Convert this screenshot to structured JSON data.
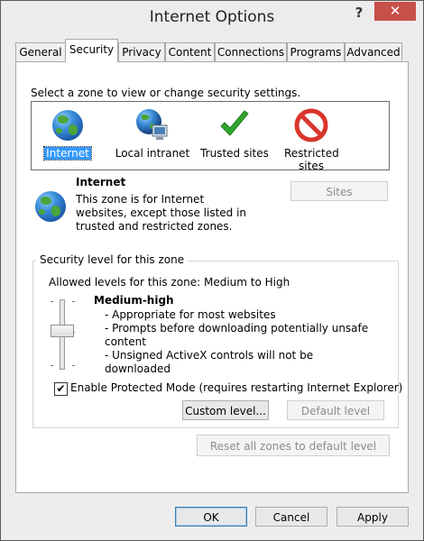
{
  "window": {
    "title": "Internet Options",
    "help_label": "?",
    "close_label": "✕"
  },
  "tabs": [
    {
      "label": "General"
    },
    {
      "label": "Security"
    },
    {
      "label": "Privacy"
    },
    {
      "label": "Content"
    },
    {
      "label": "Connections"
    },
    {
      "label": "Programs"
    },
    {
      "label": "Advanced"
    }
  ],
  "security": {
    "zone_prompt": "Select a zone to view or change security settings.",
    "zones": [
      {
        "label": "Internet",
        "icon": "globe-icon"
      },
      {
        "label": "Local intranet",
        "icon": "intranet-icon"
      },
      {
        "label": "Trusted sites",
        "icon": "checkmark-icon"
      },
      {
        "label": "Restricted sites",
        "icon": "restricted-icon"
      }
    ],
    "selected_zone": {
      "name": "Internet",
      "description": "This zone is for Internet websites, except those listed in trusted and restricted zones."
    },
    "sites_label": "Sites",
    "level_group_label": "Security level for this zone",
    "allowed_levels": "Allowed levels for this zone: Medium to High",
    "level_name": "Medium-high",
    "level_bullets": [
      "- Appropriate for most websites",
      "- Prompts before downloading potentially unsafe content",
      "- Unsigned ActiveX controls will not be downloaded"
    ],
    "protected_mode": {
      "checked": true,
      "label": "Enable Protected Mode (requires restarting Internet Explorer)"
    },
    "custom_level_label": "Custom level...",
    "default_level_label": "Default level",
    "reset_all_label": "Reset all zones to default level"
  },
  "footer": {
    "ok_label": "OK",
    "cancel_label": "Cancel",
    "apply_label": "Apply"
  },
  "colors": {
    "close_button": "#c7504b",
    "selection": "#3399ff",
    "check_green": "#2ea62e",
    "restricted_red": "#d9352b"
  }
}
